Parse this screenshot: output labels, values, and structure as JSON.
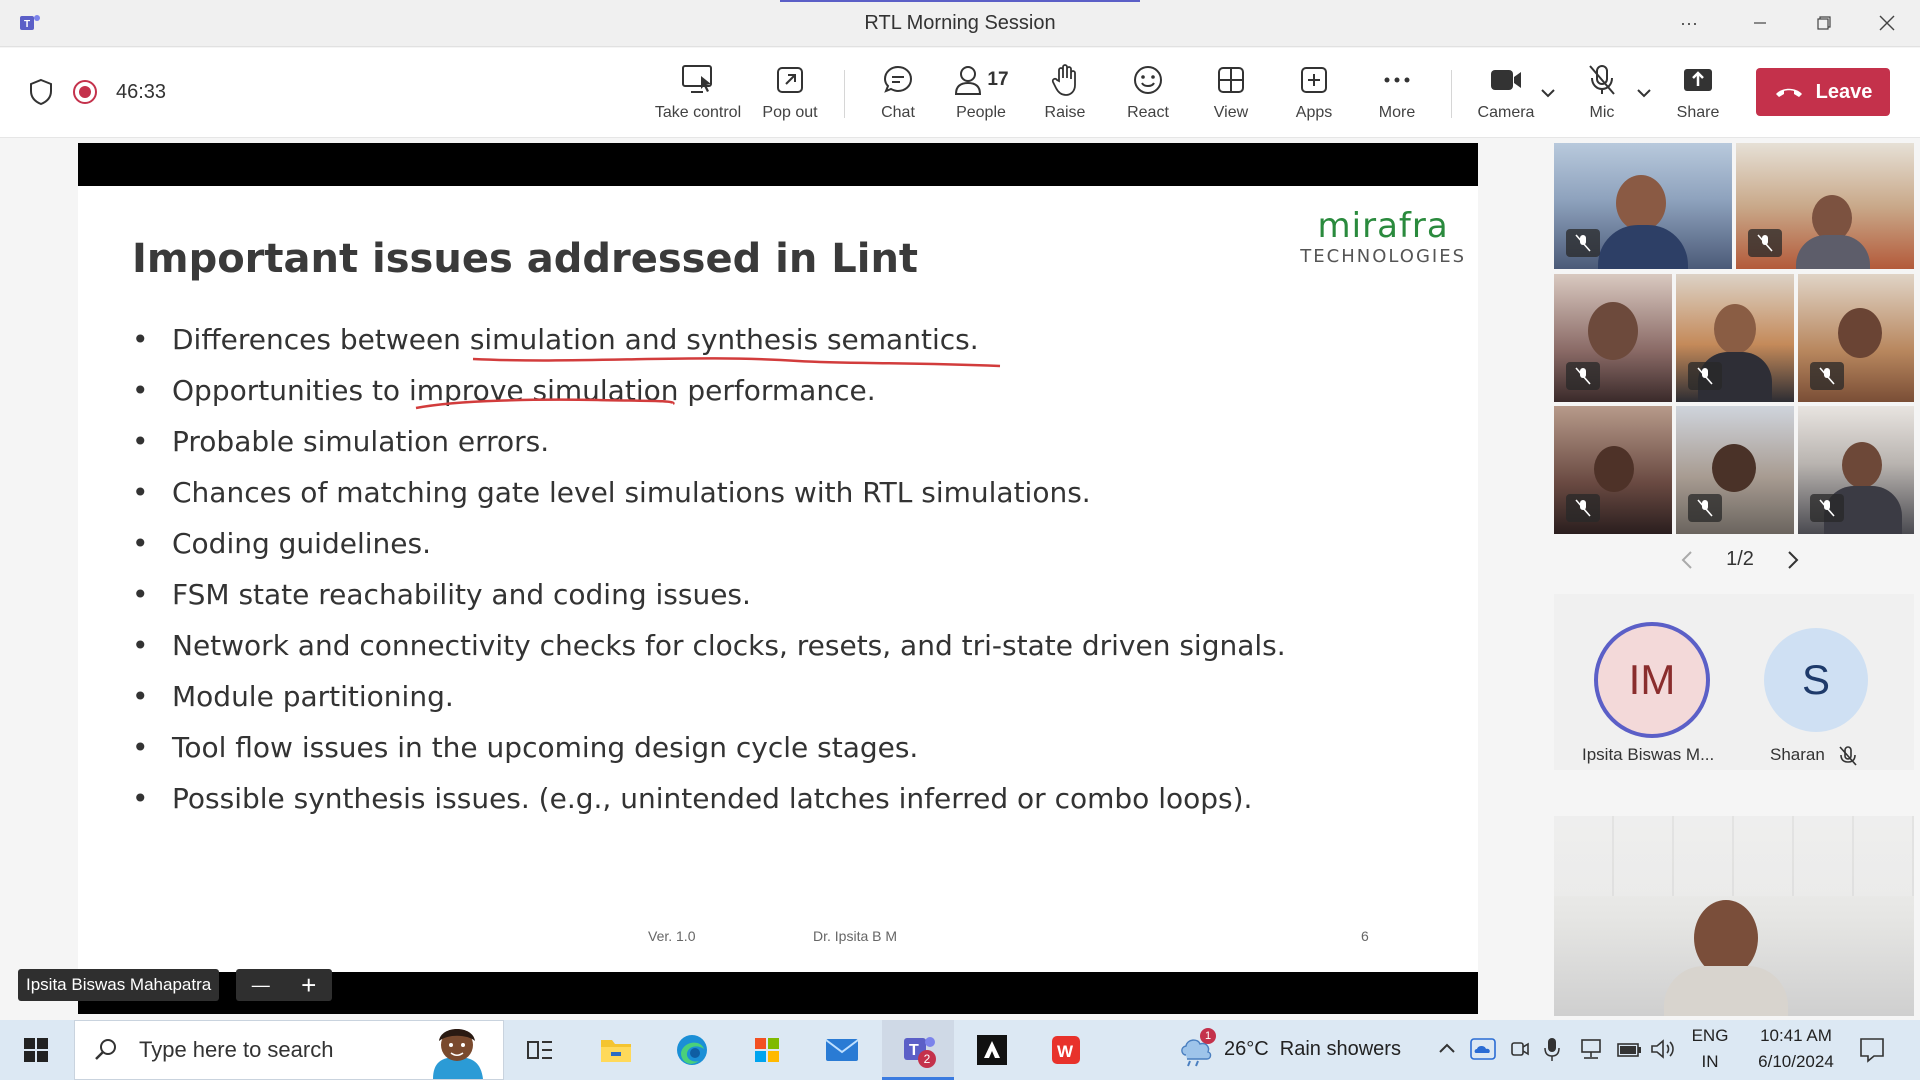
{
  "window": {
    "title": "RTL Morning Session"
  },
  "toolbar": {
    "timer": "46:33",
    "buttons": {
      "take_control": "Take control",
      "pop_out": "Pop out",
      "chat": "Chat",
      "people": "People",
      "people_count": "17",
      "raise": "Raise",
      "react": "React",
      "view": "View",
      "apps": "Apps",
      "more": "More",
      "camera": "Camera",
      "mic": "Mic",
      "share": "Share",
      "leave": "Leave"
    }
  },
  "slide": {
    "title": "Important issues addressed in Lint",
    "logo_brand": "mirafra",
    "logo_sub": "TECHNOLOGIES",
    "bullets": [
      "Differences between simulation and synthesis semantics.",
      "Opportunities to improve simulation performance.",
      "Probable simulation errors.",
      "Chances of matching gate level simulations with RTL simulations.",
      "Coding guidelines.",
      "FSM state reachability and coding issues.",
      "Network and connectivity checks for clocks, resets, and tri-state driven signals.",
      "Module partitioning.",
      "Tool flow issues in the upcoming design cycle stages.",
      "Possible synthesis issues. (e.g., unintended latches inferred or combo loops)."
    ],
    "footer": {
      "version": "Ver. 1.0",
      "author": "Dr. Ipsita B M",
      "page": "6"
    }
  },
  "presenter": {
    "name": "Ipsita Biswas Mahapatra",
    "zoom_out": "—",
    "zoom_in": "+"
  },
  "participants": {
    "pager": "1/2",
    "avatars": [
      {
        "initials": "IM",
        "name": "Ipsita Biswas M..."
      },
      {
        "initials": "S",
        "name": "Sharan"
      }
    ]
  },
  "taskbar": {
    "search_placeholder": "Type here to search",
    "teams_badge": "2",
    "weather_badge": "1",
    "weather": "26°C  Rain showers",
    "lang_top": "ENG",
    "lang_bottom": "IN",
    "time": "10:41 AM",
    "date": "6/10/2024"
  },
  "colors": {
    "leave": "#c4314b",
    "brand_green": "#2a8a3d",
    "teams_purple": "#5b5fc7",
    "avatar_im_bg": "#f3d9d9",
    "avatar_s_bg": "#cfe0f3"
  }
}
